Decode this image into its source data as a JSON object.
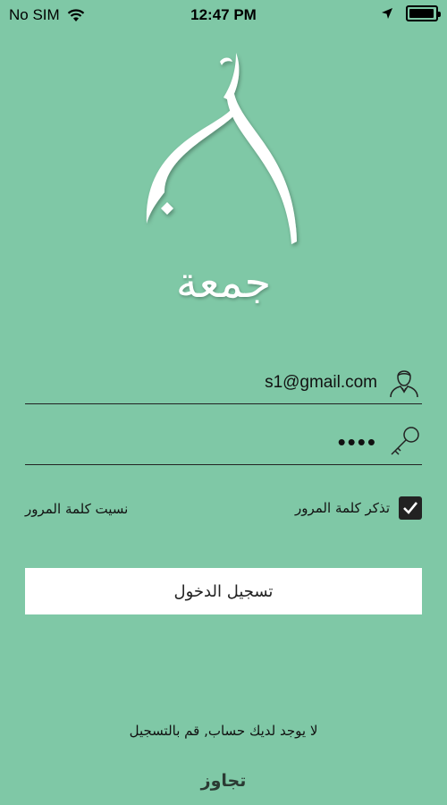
{
  "status_bar": {
    "carrier": "No SIM",
    "time": "12:47 PM",
    "battery_level": 0.95
  },
  "brand": {
    "name": "جمعة",
    "logo_icon": "crescent-dome-logo-icon",
    "text_color": "#ffffff"
  },
  "login_form": {
    "email_value": "s1@gmail.com",
    "email_icon": "user-icon",
    "password_value": "••••",
    "password_icon": "key-icon",
    "remember_label": "تذكر كلمة المرور",
    "remember_checked": true,
    "forgot_label": "نسيت كلمة المرور",
    "submit_label": "تسجيل الدخول"
  },
  "footer": {
    "register_text": "لا يوجد لديك حساب, قم بالتسجيل",
    "skip_label": "تجاوز"
  },
  "theme": {
    "background": "#7fc8a6",
    "button_background": "#ffffff",
    "dark": "#222222"
  }
}
